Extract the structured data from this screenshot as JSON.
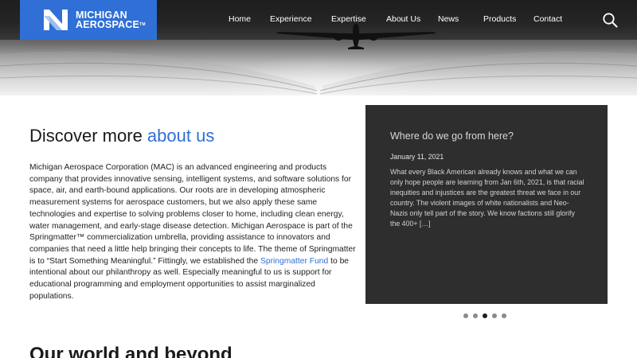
{
  "header": {
    "logo_line1": "MICHIGAN",
    "logo_line2": "AEROSPACE",
    "logo_tm": "TM",
    "nav": [
      {
        "label": "Home"
      },
      {
        "label": "Experience"
      },
      {
        "label": "Expertise"
      },
      {
        "label": "About Us"
      },
      {
        "label": "News"
      },
      {
        "label": "Products"
      },
      {
        "label": "Contact"
      }
    ]
  },
  "about": {
    "title_plain": "Discover more ",
    "title_accent": "about us",
    "paragraph_part1": "Michigan Aerospace Corporation (MAC) is an advanced engineering and products company that provides innovative sensing, intelligent systems, and software solutions for space, air, and earth-bound applications. Our roots are in developing atmospheric measurement systems for aerospace customers, but we also apply these same technologies and expertise to solving problems closer to home, including clean energy, water management, and early-stage disease detection. Michigan Aerospace is part of the Springmatter™ commercialization umbrella, providing assistance to innovators and companies that need a little help bringing their concepts to life. The theme of Springmatter is to “Start Something Meaningful.” Fittingly, we established the ",
    "link_text": "Springmatter Fund",
    "paragraph_part2": " to be intentional about our philanthropy as well. Especially meaningful to us is support for educational programming and employment opportunities to assist marginalized populations."
  },
  "news_card": {
    "title": "Where do we go from here?",
    "date": "January 11, 2021",
    "excerpt": "What every Black American already knows and what we can only hope people are learning from Jan 6th, 2021, is that racial inequities and injustices are the greatest threat we face in our country. The violent images of white nationalists and Neo-Nazis only tell part of the story. We know factions still glorify the 400+ […]",
    "slides_total": 5,
    "active_slide": 3
  },
  "world": {
    "title": "Our world and beyond"
  },
  "colors": {
    "accent": "#2f6fd6",
    "card_bg": "#2e2e2e",
    "nav_overlay": "rgba(20,20,20,0.55)"
  },
  "icons": {
    "search": "search-icon",
    "logo": "michigan-aerospace-logo-icon",
    "plane": "airplane-icon"
  }
}
